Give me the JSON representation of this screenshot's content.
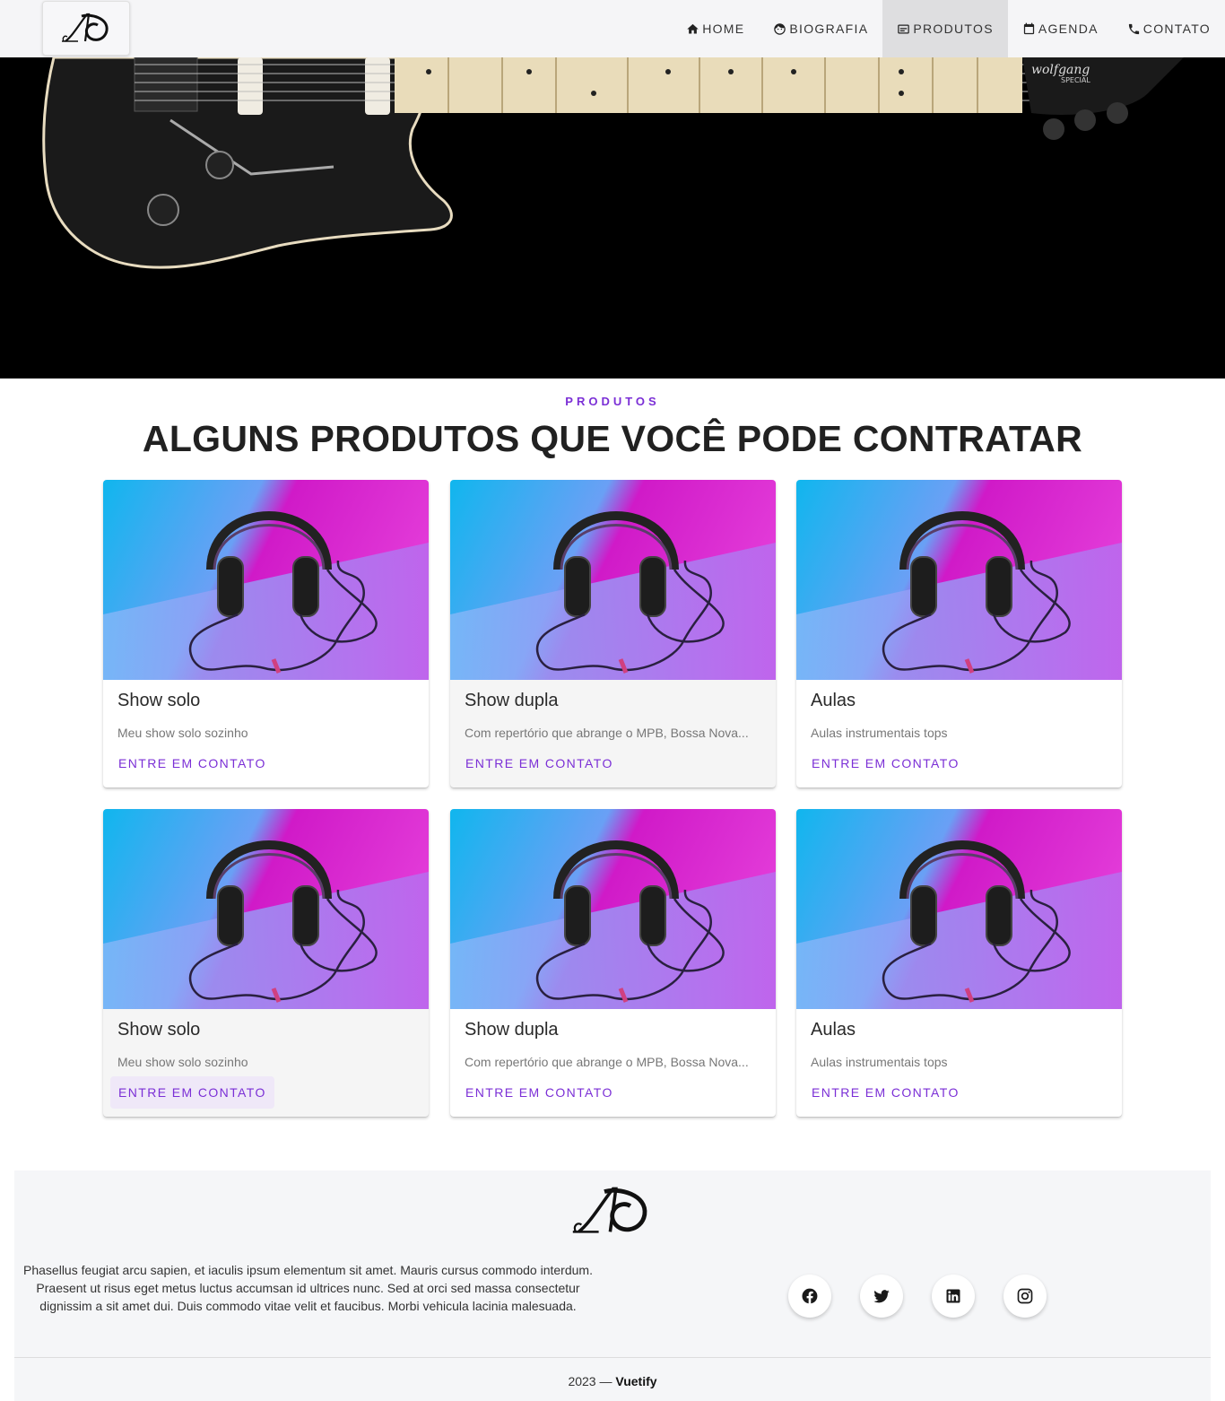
{
  "nav": {
    "items": [
      {
        "label": "HOME",
        "icon": "home-icon"
      },
      {
        "label": "BIOGRAFIA",
        "icon": "face-icon"
      },
      {
        "label": "PRODUTOS",
        "icon": "card-icon",
        "active": true
      },
      {
        "label": "AGENDA",
        "icon": "calendar-icon"
      },
      {
        "label": "CONTATO",
        "icon": "phone-icon"
      }
    ]
  },
  "hero": {
    "brand_text": "wolfgang",
    "brand_sub": "SPECIAL"
  },
  "section": {
    "overline": "PRODUTOS",
    "headline": "ALGUNS PRODUTOS QUE VOCÊ PODE CONTRATAR"
  },
  "cards": [
    {
      "title": "Show solo",
      "subtitle": "Meu show solo sozinho",
      "button": "ENTRE EM CONTATO"
    },
    {
      "title": "Show dupla",
      "subtitle": "Com repertório que abrange o MPB, Bossa Nova...",
      "button": "ENTRE EM CONTATO"
    },
    {
      "title": "Aulas",
      "subtitle": "Aulas instrumentais tops",
      "button": "ENTRE EM CONTATO"
    },
    {
      "title": "Show solo",
      "subtitle": "Meu show solo sozinho",
      "button": "ENTRE EM CONTATO"
    },
    {
      "title": "Show dupla",
      "subtitle": "Com repertório que abrange o MPB, Bossa Nova...",
      "button": "ENTRE EM CONTATO"
    },
    {
      "title": "Aulas",
      "subtitle": "Aulas instrumentais tops",
      "button": "ENTRE EM CONTATO"
    }
  ],
  "footer": {
    "text": "Phasellus feugiat arcu sapien, et iaculis ipsum elementum sit amet. Mauris cursus commodo interdum. Praesent ut risus eget metus luctus accumsan id ultrices nunc. Sed at orci sed massa consectetur dignissim a sit amet dui. Duis commodo vitae velit et faucibus. Morbi vehicula lacinia malesuada.",
    "year": "2023 —",
    "brand": "Vuetify",
    "socials": [
      "facebook-icon",
      "twitter-icon",
      "linkedin-icon",
      "instagram-icon"
    ]
  },
  "colors": {
    "accent": "#7b2fd6",
    "hero_bg": "#000000",
    "footer_bg": "#f5f6f8"
  }
}
